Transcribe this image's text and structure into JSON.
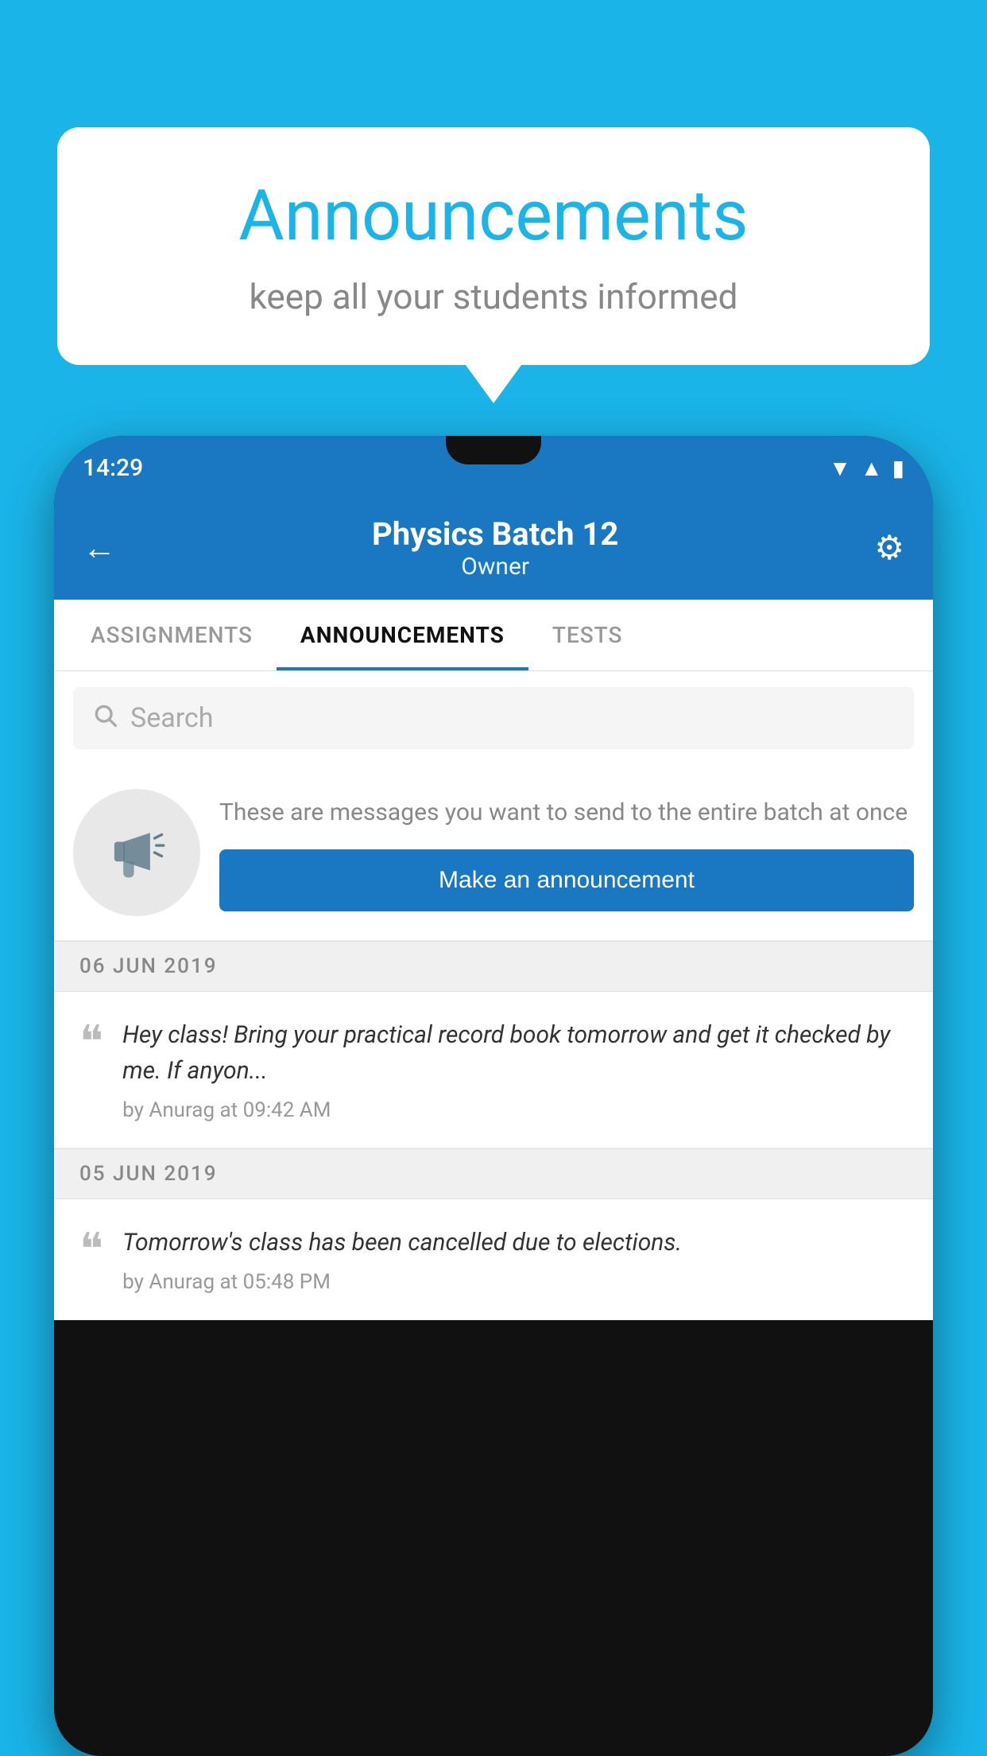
{
  "background_color": "#1ab4e8",
  "bubble": {
    "title": "Announcements",
    "subtitle": "keep all your students informed"
  },
  "phone": {
    "status_bar": {
      "time": "14:29",
      "icons": [
        "wifi",
        "signal",
        "battery"
      ]
    },
    "header": {
      "title": "Physics Batch 12",
      "subtitle": "Owner",
      "back_label": "←",
      "gear_label": "⚙"
    },
    "tabs": [
      {
        "label": "ASSIGNMENTS",
        "active": false
      },
      {
        "label": "ANNOUNCEMENTS",
        "active": true
      },
      {
        "label": "TESTS",
        "active": false
      }
    ],
    "search": {
      "placeholder": "Search"
    },
    "promo": {
      "description": "These are messages you want to send to the entire batch at once",
      "button_label": "Make an announcement"
    },
    "announcements": [
      {
        "date": "06  JUN  2019",
        "preview": "Hey class! Bring your practical record book tomorrow and get it checked by me. If anyon...",
        "meta": "by Anurag at 09:42 AM"
      },
      {
        "date": "05  JUN  2019",
        "preview": "Tomorrow's class has been cancelled due to elections.",
        "meta": "by Anurag at 05:48 PM"
      }
    ]
  }
}
